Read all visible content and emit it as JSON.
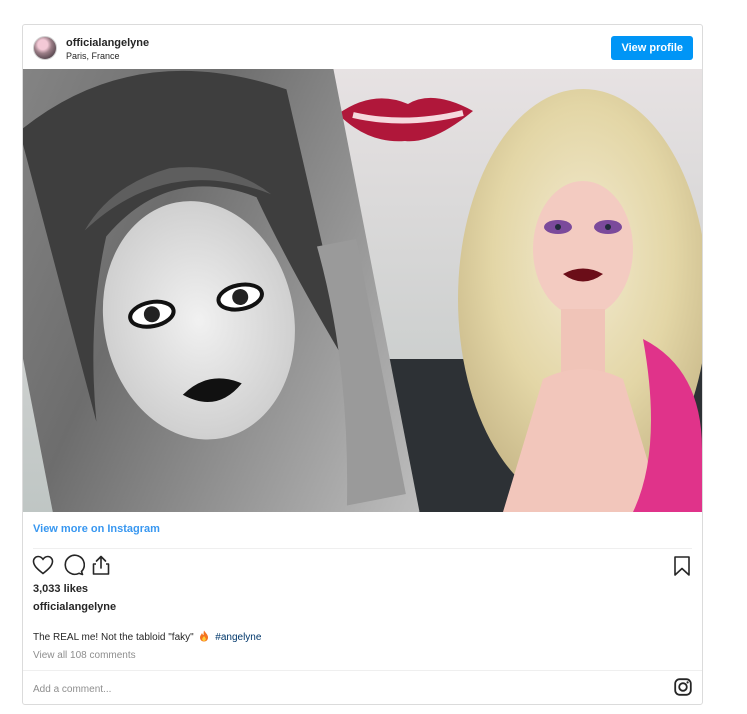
{
  "post": {
    "username": "officialangelyne",
    "location": "Paris, France",
    "view_profile_label": "View profile",
    "view_more_label": "View more on Instagram",
    "likes": "3,033 likes",
    "owner": "officialangelyne",
    "caption_text": "The REAL me! Not the tabloid \"faky\"",
    "caption_hashtag": "#angelyne",
    "comments_link": "View all 108 comments",
    "add_comment_placeholder": "Add a comment...",
    "colors": {
      "accent": "#0095f6",
      "link": "#3897f0",
      "hashtag": "#00376b",
      "border": "#dbdbdb"
    },
    "icons": [
      "heart-icon",
      "comment-icon",
      "share-icon",
      "bookmark-icon",
      "flame-emoji",
      "instagram-icon"
    ]
  }
}
